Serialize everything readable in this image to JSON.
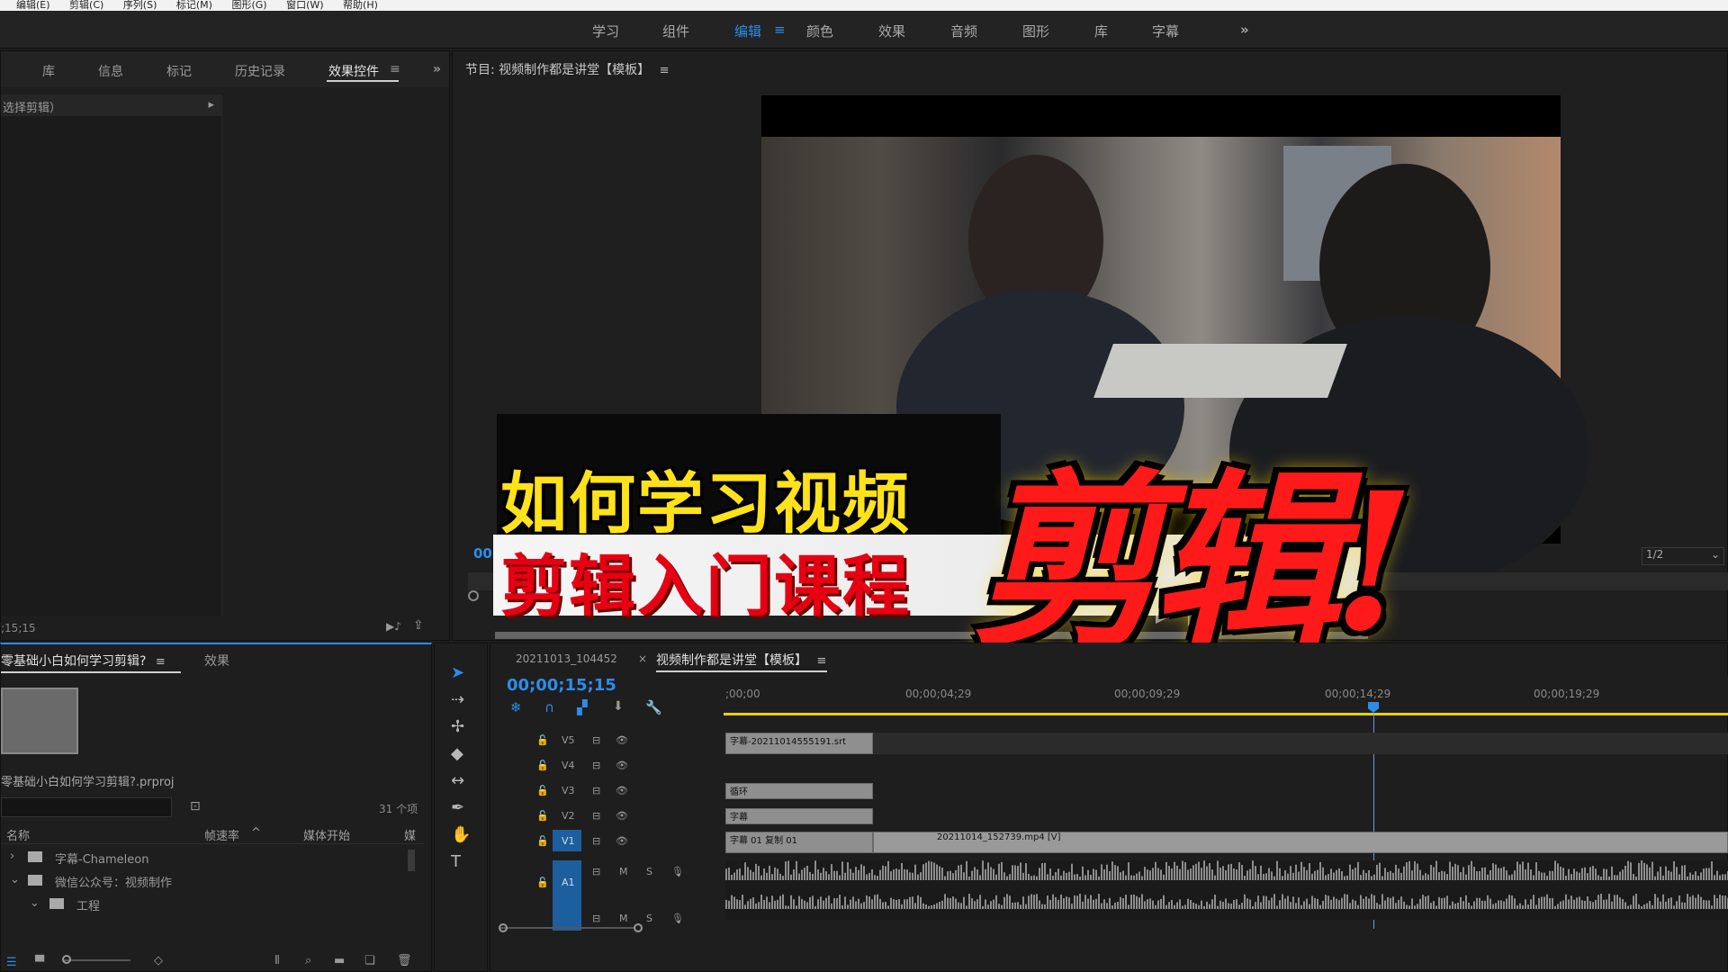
{
  "menubar": {
    "items": [
      "编辑(E)",
      "剪辑(C)",
      "序列(S)",
      "标记(M)",
      "图形(G)",
      "窗口(W)",
      "帮助(H)"
    ]
  },
  "workspaces": {
    "tabs": [
      "学习",
      "组件",
      "编辑",
      "颜色",
      "效果",
      "音频",
      "图形",
      "库",
      "字幕"
    ],
    "active": "编辑",
    "more": "»"
  },
  "source_panel": {
    "tabs": [
      "库",
      "信息",
      "标记",
      "历史记录",
      "效果控件"
    ],
    "active": "效果控件",
    "no_clip": "选择剪辑）",
    "timecode": ";15;15",
    "more": "»"
  },
  "program_monitor": {
    "title": "节目: 视频制作都是讲堂【模板】",
    "timecode": "00;",
    "resolution": "1/2"
  },
  "overlay": {
    "line1": "如何学习视频",
    "line2": "剪辑入门课程",
    "big": "剪辑!"
  },
  "project_panel": {
    "tab": "零基础小白如何学习剪辑?",
    "tab2": "效果",
    "project_file": "零基础小白如何学习剪辑?.prproj",
    "item_count": "31 个项",
    "columns": [
      "名称",
      "帧速率",
      "媒体开始",
      "媒"
    ],
    "rows": [
      {
        "name": "字幕-Chameleon",
        "expanded": false
      },
      {
        "name": "微信公众号：视频制作",
        "expanded": true
      },
      {
        "name": "工程",
        "expanded": true
      }
    ]
  },
  "timeline": {
    "tabs": [
      "20211013_104452",
      "视频制作都是讲堂【模板】"
    ],
    "active_tab": "视频制作都是讲堂【模板】",
    "close_mark": "×",
    "timecode": "00;00;15;15",
    "ruler": [
      ";00;00",
      "00;00;04;29",
      "00;00;09;29",
      "00;00;14;29",
      "00;00;19;29"
    ],
    "tracks": [
      "V5",
      "V4",
      "V3",
      "V2",
      "V1",
      "A1"
    ],
    "clips": {
      "v5": "字幕-20211014555191.srt",
      "v3": "循环",
      "v2": "字幕",
      "v1a": "字幕 01 复制 01",
      "v1b": "20211014_152739.mp4 [V]"
    },
    "track_buttons": {
      "mute": "M",
      "solo": "S"
    }
  },
  "colors": {
    "accent": "#2d8ceb",
    "playhead": "#2d8ceb",
    "work_area": "#e8d200"
  }
}
